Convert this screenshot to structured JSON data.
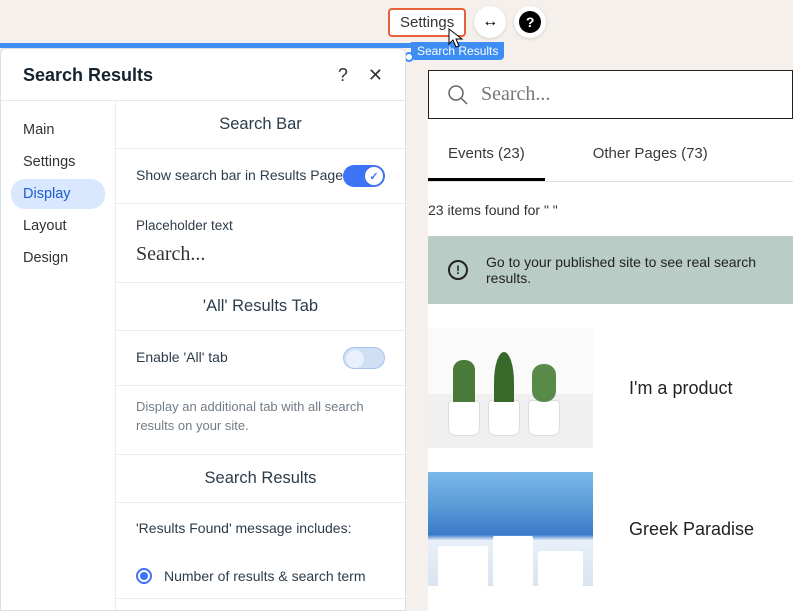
{
  "toolbar": {
    "settings_label": "Settings"
  },
  "selection": {
    "label": "Search Results"
  },
  "panel": {
    "title": "Search Results",
    "help": "?",
    "close": "✕",
    "nav": {
      "main": "Main",
      "settings": "Settings",
      "display": "Display",
      "layout": "Layout",
      "design": "Design"
    },
    "sections": {
      "search_bar": {
        "heading": "Search Bar",
        "show_label": "Show search bar in Results Page",
        "show_enabled": true,
        "placeholder_label": "Placeholder text",
        "placeholder_value": "Search..."
      },
      "all_tab": {
        "heading": "'All' Results Tab",
        "enable_label": "Enable 'All' tab",
        "enable_enabled": false,
        "help_text": "Display an additional tab with all search results on your site."
      },
      "search_results": {
        "heading": "Search Results",
        "message_label": "'Results Found' message includes:",
        "option1": "Number of results & search term"
      }
    }
  },
  "preview": {
    "search_placeholder": "Search...",
    "tabs": {
      "events": "Events (23)",
      "other": "Other Pages (73)"
    },
    "items_found": "23 items found for \" \"",
    "banner": "Go to your published site to see real search results.",
    "results": [
      {
        "title": "I'm a product"
      },
      {
        "title": "Greek Paradise"
      }
    ]
  }
}
